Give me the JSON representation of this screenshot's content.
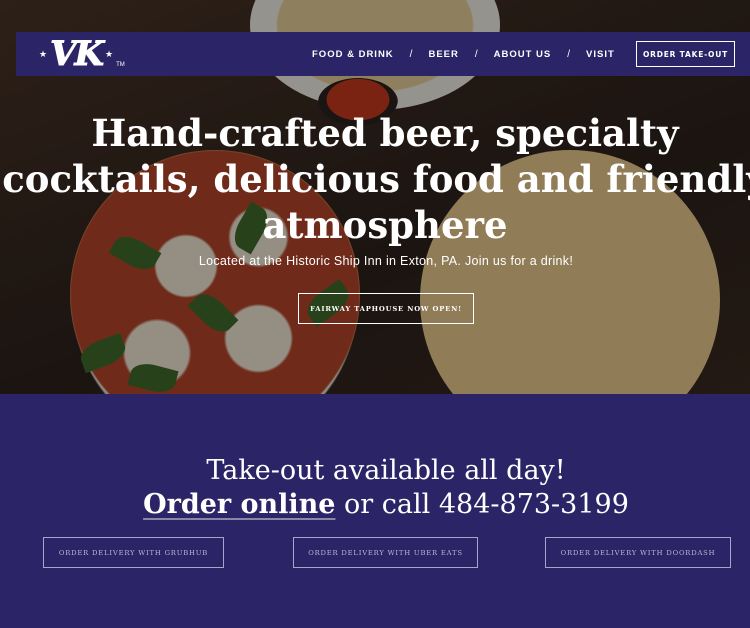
{
  "nav": {
    "logo_text": "VK",
    "logo_tm": "TM",
    "links": [
      "FOOD & DRINK",
      "BEER",
      "ABOUT US",
      "VISIT"
    ],
    "separator": "/",
    "order_button": "ORDER TAKE-OUT"
  },
  "hero": {
    "title": "Hand-crafted beer, specialty cocktails, delicious food and friendly atmosphere",
    "subtitle": "Located at the Historic Ship Inn in Exton, PA. Join us for a drink!",
    "button": "FAIRWAY TAPHOUSE NOW OPEN!"
  },
  "takeout": {
    "line1": "Take-out available all day!",
    "order_link": "Order online",
    "call_text": " or call 484-873-3199",
    "buttons": [
      "ORDER DELIVERY WITH GRUBHUB",
      "ORDER DELIVERY WITH UBER EATS",
      "ORDER DELIVERY WITH DOORDASH"
    ]
  },
  "colors": {
    "brand_navy": "#2b2466",
    "text": "#ffffff"
  }
}
